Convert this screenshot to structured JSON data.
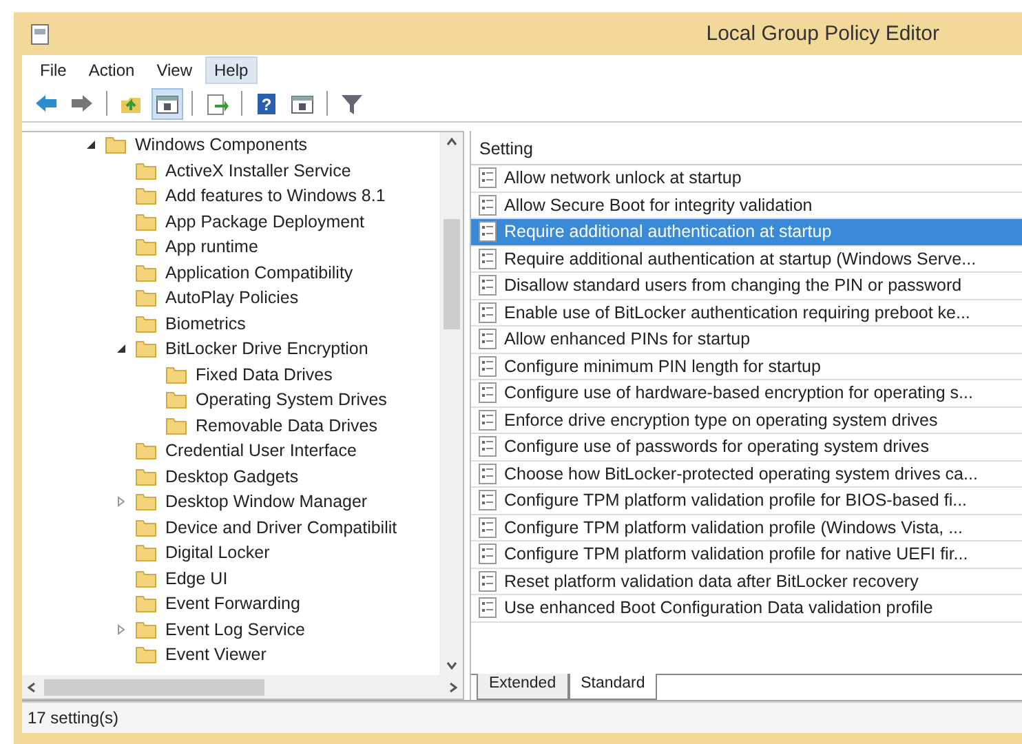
{
  "window": {
    "title": "Local Group Policy Editor"
  },
  "menu": [
    {
      "label": "File",
      "selected": false
    },
    {
      "label": "Action",
      "selected": false
    },
    {
      "label": "View",
      "selected": false
    },
    {
      "label": "Help",
      "selected": true
    }
  ],
  "toolbar": [
    {
      "kind": "back"
    },
    {
      "kind": "forward"
    },
    {
      "kind": "sep"
    },
    {
      "kind": "up"
    },
    {
      "kind": "panel",
      "selected": true
    },
    {
      "kind": "sep"
    },
    {
      "kind": "export"
    },
    {
      "kind": "sep"
    },
    {
      "kind": "help",
      "glyph": "?"
    },
    {
      "kind": "panel",
      "selected": false
    },
    {
      "kind": "sep"
    },
    {
      "kind": "filter"
    }
  ],
  "tree": {
    "items": [
      {
        "label": "Windows Components",
        "expanded": true,
        "children": [
          {
            "label": "ActiveX Installer Service"
          },
          {
            "label": "Add features to Windows 8.1"
          },
          {
            "label": "App Package Deployment"
          },
          {
            "label": "App runtime"
          },
          {
            "label": "Application Compatibility"
          },
          {
            "label": "AutoPlay Policies"
          },
          {
            "label": "Biometrics"
          },
          {
            "label": "BitLocker Drive Encryption",
            "expanded": true,
            "children": [
              {
                "label": "Fixed Data Drives"
              },
              {
                "label": "Operating System Drives"
              },
              {
                "label": "Removable Data Drives"
              }
            ]
          },
          {
            "label": "Credential User Interface"
          },
          {
            "label": "Desktop Gadgets"
          },
          {
            "label": "Desktop Window Manager",
            "expanded": false
          },
          {
            "label": "Device and Driver Compatibilit"
          },
          {
            "label": "Digital Locker"
          },
          {
            "label": "Edge UI"
          },
          {
            "label": "Event Forwarding"
          },
          {
            "label": "Event Log Service",
            "expanded": false
          },
          {
            "label": "Event Viewer"
          }
        ]
      }
    ]
  },
  "settings": {
    "column": "Setting",
    "rows": [
      {
        "label": "Allow network unlock at startup",
        "selected": false
      },
      {
        "label": "Allow Secure Boot for integrity validation",
        "selected": false
      },
      {
        "label": "Require additional authentication at startup",
        "selected": true
      },
      {
        "label": "Require additional authentication at startup (Windows Serve...",
        "selected": false
      },
      {
        "label": "Disallow standard users from changing the PIN or password",
        "selected": false
      },
      {
        "label": "Enable use of BitLocker authentication requiring preboot ke...",
        "selected": false
      },
      {
        "label": "Allow enhanced PINs for startup",
        "selected": false
      },
      {
        "label": "Configure minimum PIN length for startup",
        "selected": false
      },
      {
        "label": "Configure use of hardware-based encryption for operating s...",
        "selected": false
      },
      {
        "label": "Enforce drive encryption type on operating system drives",
        "selected": false
      },
      {
        "label": "Configure use of passwords for operating system drives",
        "selected": false
      },
      {
        "label": "Choose how BitLocker-protected operating system drives ca...",
        "selected": false
      },
      {
        "label": "Configure TPM platform validation profile for BIOS-based fi...",
        "selected": false
      },
      {
        "label": "Configure TPM platform validation profile (Windows Vista, ...",
        "selected": false
      },
      {
        "label": "Configure TPM platform validation profile for native UEFI fir...",
        "selected": false
      },
      {
        "label": "Reset platform validation data after BitLocker recovery",
        "selected": false
      },
      {
        "label": "Use enhanced Boot Configuration Data validation profile",
        "selected": false
      }
    ],
    "tabs": [
      {
        "label": "Extended",
        "selected": false
      },
      {
        "label": "Standard",
        "selected": true
      }
    ]
  },
  "status_bar": "17 setting(s)"
}
